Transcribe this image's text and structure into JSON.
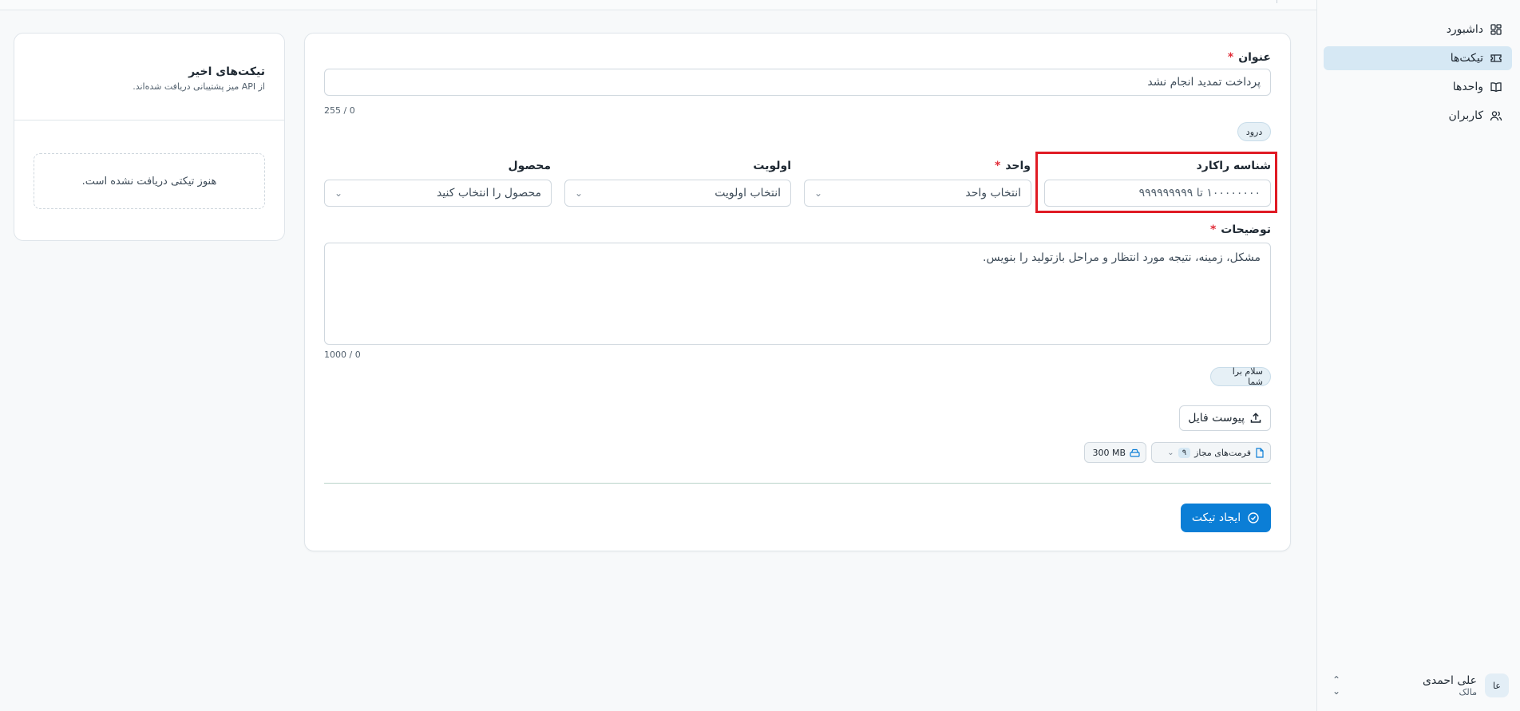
{
  "sidebar": {
    "items": [
      {
        "label": "داشبورد",
        "icon": "dashboard-icon"
      },
      {
        "label": "تیکت‌ها",
        "icon": "ticket-icon",
        "active": true
      },
      {
        "label": "واحدها",
        "icon": "book-icon"
      },
      {
        "label": "کاربران",
        "icon": "users-icon"
      }
    ],
    "user": {
      "initials": "عا",
      "name": "علی احمدی",
      "role": "مالک"
    }
  },
  "form": {
    "title_label": "عنوان",
    "title_value": "پرداخت تمدید انجام نشد",
    "title_counter": "255 / 0",
    "title_chip": "درود",
    "rakard_label": "شناسه راکارد",
    "rakard_placeholder": "۱۰۰۰۰۰۰۰۰ تا ۹۹۹۹۹۹۹۹۹",
    "unit_label": "واحد",
    "unit_placeholder": "انتخاب واحد",
    "priority_label": "اولویت",
    "priority_placeholder": "انتخاب اولویت",
    "product_label": "محصول",
    "product_placeholder": "محصول را انتخاب کنید",
    "description_label": "توضیحات",
    "description_placeholder": "مشکل، زمینه، نتیجه مورد انتظار و مراحل بازتولید را بنویس.",
    "description_counter": "1000 / 0",
    "description_chip": "سلام برا شما",
    "attach_label": "پیوست فایل",
    "formats_label": "فرمت‌های مجاز",
    "formats_count": "۹",
    "size_label": "300 MB",
    "submit_label": "ایجاد تیکت",
    "required_mark": "*"
  },
  "recent": {
    "title": "تیکت‌های اخیر",
    "subtitle": "از API میز پشتیبانی دریافت شده‌اند.",
    "empty": "هنوز تیکتی دریافت نشده است."
  },
  "colors": {
    "accent": "#0b7ed6",
    "highlight": "#e01b24",
    "active_nav": "#d6e8f4"
  }
}
